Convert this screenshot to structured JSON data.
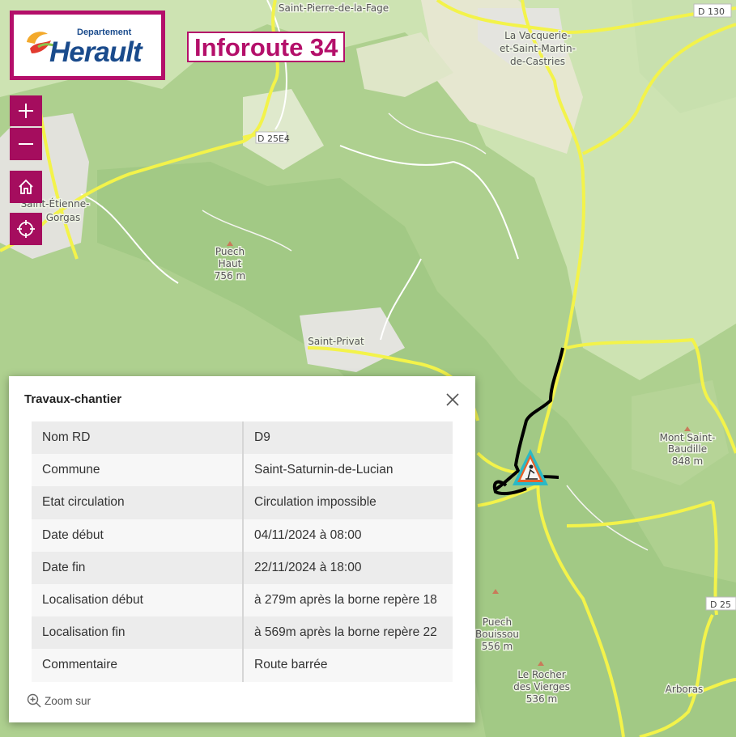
{
  "app": {
    "logo_small": "Departement",
    "logo_big": "Herault",
    "title": "Inforoute 34"
  },
  "map_controls": {
    "zoom_in_icon": "plus-icon",
    "zoom_out_icon": "minus-icon",
    "home_icon": "home-icon",
    "locate_icon": "crosshair-icon"
  },
  "map_labels": {
    "p1": "Saint-Pierre-de-la-Fage",
    "p2a": "La Vacquerie-",
    "p2b": "et-Saint-Martin-",
    "p2c": "de-Castries",
    "p3a": "Saint-Étienne-",
    "p3b": "Gorgas",
    "p4a": "Puech",
    "p4b": "Haut",
    "p4c": "756 m",
    "p5": "Saint-Privat",
    "p6a": "Mont Saint-",
    "p6b": "Baudille",
    "p6c": "848 m",
    "p7a": "Puech",
    "p7b": "Bouissou",
    "p7c": "556 m",
    "p8a": "Le Rocher",
    "p8b": "des Vierges",
    "p8c": "536 m",
    "p9": "Arboras",
    "r1": "D 130",
    "r2": "D 25E4",
    "r3": "D 25"
  },
  "popup": {
    "title": "Travaux-chantier",
    "close_icon": "close-icon",
    "rows": [
      {
        "k": "Nom RD",
        "v": "D9"
      },
      {
        "k": "Commune",
        "v": "Saint-Saturnin-de-Lucian"
      },
      {
        "k": "Etat circulation",
        "v": "Circulation impossible"
      },
      {
        "k": "Date début",
        "v": "04/11/2024 à 08:00"
      },
      {
        "k": "Date fin",
        "v": "22/11/2024 à 18:00"
      },
      {
        "k": "Localisation début",
        "v": "à 279m après la borne repère 18"
      },
      {
        "k": "Localisation fin",
        "v": "à 569m après la borne repère 22"
      },
      {
        "k": "Commentaire",
        "v": "Route barrée"
      }
    ],
    "zoom_label": "Zoom sur",
    "zoom_icon": "zoom-in-icon"
  },
  "marker": {
    "icon": "roadworks-icon",
    "color": "#2ab9c6"
  },
  "colors": {
    "brand": "#b40f6a",
    "road": "#f3f34a",
    "closed_segment": "#000000"
  }
}
